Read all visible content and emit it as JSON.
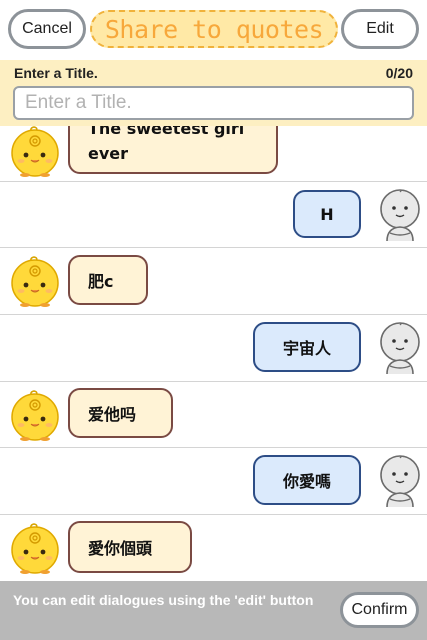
{
  "header": {
    "cancel_label": "Cancel",
    "title": "Share to quotes",
    "edit_label": "Edit"
  },
  "title_panel": {
    "label": "Enter a Title.",
    "counter": "0/20",
    "input_placeholder": "Enter a Title.",
    "input_value": ""
  },
  "messages": [
    {
      "speaker": "simsimi",
      "line1": "The sweetest girl",
      "line2": "ever"
    },
    {
      "speaker": "user",
      "text": "H"
    },
    {
      "speaker": "simsimi",
      "text": "肥c"
    },
    {
      "speaker": "user",
      "text": "宇宙人"
    },
    {
      "speaker": "simsimi",
      "text": "爱他吗"
    },
    {
      "speaker": "user",
      "text": "你愛嗎"
    },
    {
      "speaker": "simsimi",
      "text": "愛你個頭"
    }
  ],
  "footer": {
    "hint": "You can edit dialogues using the 'edit' button",
    "confirm_label": "Confirm"
  },
  "colors": {
    "title_text": "#f7a83b",
    "title_fill": "#ffe9a6",
    "title_panel_bg": "#fdefc2",
    "incoming_bubble": "#fff3d6",
    "incoming_border": "#7a4a43",
    "outgoing_bubble": "#dbeafc",
    "outgoing_border": "#2d4d86",
    "footer_bg": "#b8b8b8"
  },
  "icons": {
    "simsimi_avatar": "yellow-chick-avatar-icon",
    "user_avatar": "gray-person-avatar-icon"
  }
}
